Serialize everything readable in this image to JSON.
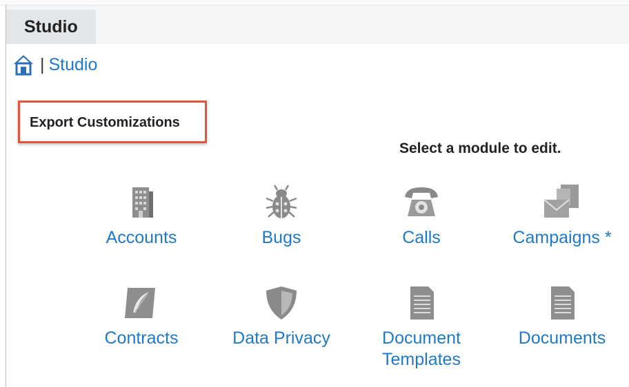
{
  "tab": {
    "label": "Studio"
  },
  "breadcrumb": {
    "separator": "|",
    "studio_link": "Studio"
  },
  "export_button": {
    "label": "Export Customizations"
  },
  "instruction": "Select a module to edit.",
  "modules": [
    {
      "label": "Accounts",
      "icon": "building-icon"
    },
    {
      "label": "Bugs",
      "icon": "bug-icon"
    },
    {
      "label": "Calls",
      "icon": "telephone-icon"
    },
    {
      "label": "Campaigns *",
      "icon": "envelopes-icon"
    },
    {
      "label": "Contracts",
      "icon": "contract-quill-icon"
    },
    {
      "label": "Data Privacy",
      "icon": "shield-icon"
    },
    {
      "label": "Document Templates",
      "icon": "document-icon"
    },
    {
      "label": "Documents",
      "icon": "document-icon"
    }
  ],
  "colors": {
    "link": "#1f79c8",
    "highlight": "#e2553d",
    "tab": "#e3e6e9",
    "icon": "#8a8a8a"
  }
}
